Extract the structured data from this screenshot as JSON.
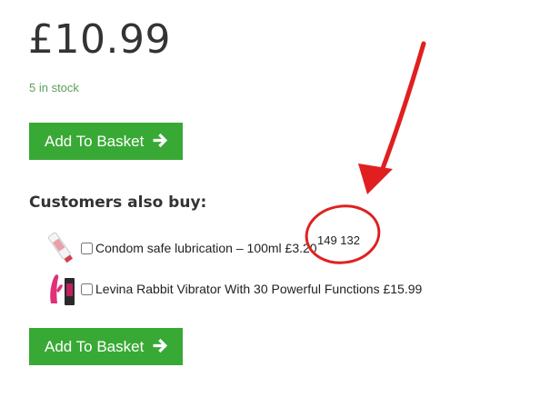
{
  "product": {
    "price": "£10.99",
    "stock": "5 in stock",
    "add_to_basket_label": "Add To Basket"
  },
  "also_buy": {
    "title": "Customers also buy:",
    "items": [
      {
        "label": "Condom safe lubrication – 100ml £3.20",
        "checked": false,
        "icon": "lube-tube-icon"
      },
      {
        "label": "Levina Rabbit Vibrator With 30 Powerful Functions £15.99",
        "checked": false,
        "icon": "vibrator-product-icon"
      }
    ]
  },
  "annotation": {
    "text": "149 132",
    "color": "#e02020"
  },
  "colors": {
    "button": "#39a935",
    "stock": "#5aa05a"
  }
}
